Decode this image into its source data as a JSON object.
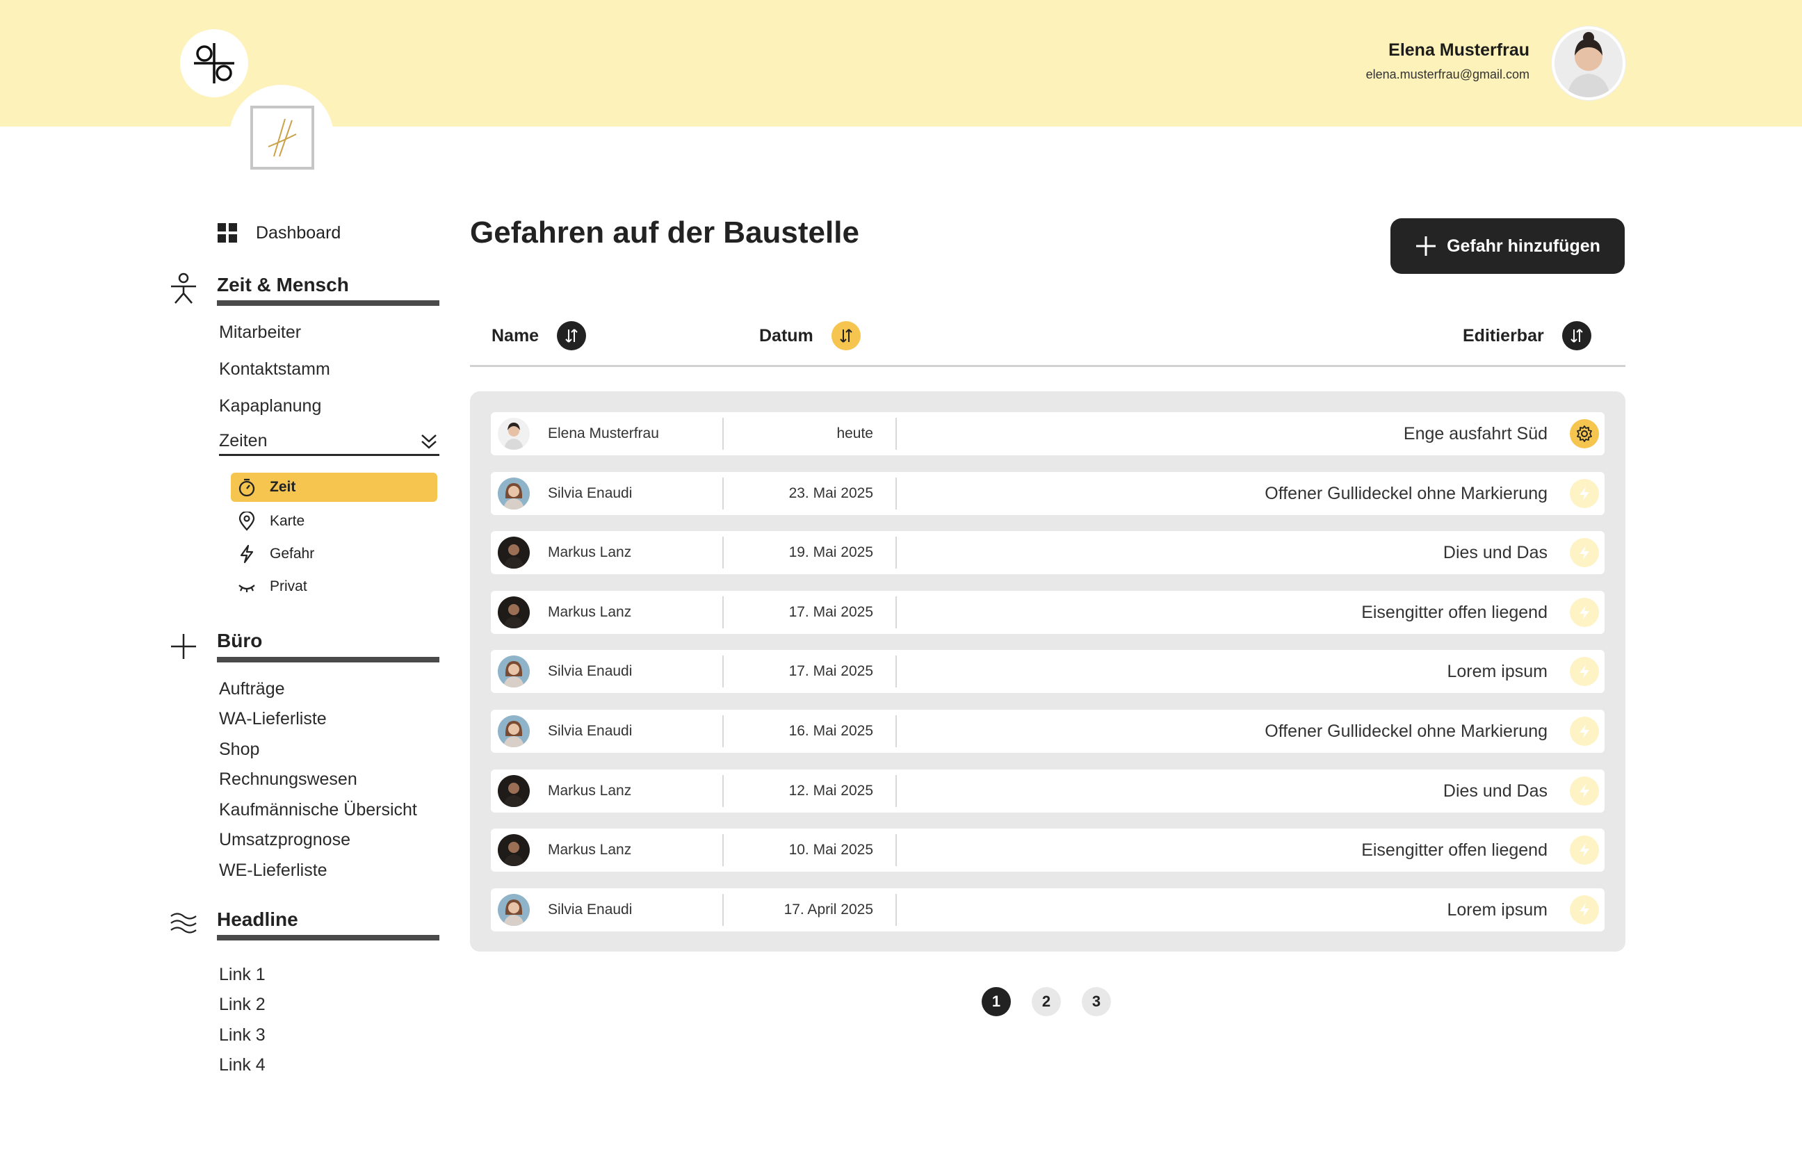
{
  "user": {
    "name": "Elena Musterfrau",
    "email": "elena.musterfrau@gmail.com"
  },
  "sidebar": {
    "dashboard": "Dashboard",
    "sections": [
      {
        "title": "Zeit & Mensch",
        "icon": "person-icon"
      },
      {
        "title": "Büro",
        "icon": "plus-icon"
      },
      {
        "title": "Headline",
        "icon": "waves-icon"
      }
    ],
    "zeit_links": [
      "Mitarbeiter",
      "Kontaktstamm",
      "Kapaplanung"
    ],
    "zeiten": "Zeiten",
    "zeiten_sub": [
      {
        "label": "Zeit",
        "icon": "stopwatch-icon",
        "active": true
      },
      {
        "label": "Karte",
        "icon": "location-pin-icon"
      },
      {
        "label": "Gefahr",
        "icon": "lightning-icon"
      },
      {
        "label": "Privat",
        "icon": "closed-eye-icon"
      }
    ],
    "buero_links": [
      "Aufträge",
      "WA-Lieferliste",
      "Shop",
      "Rechnungswesen",
      "Kaufmännische Übersicht",
      "Umsatzprognose",
      "WE-Lieferliste"
    ],
    "headline_links": [
      "Link 1",
      "Link 2",
      "Link 3",
      "Link 4"
    ]
  },
  "main": {
    "title": "Gefahren auf der Baustelle",
    "add_button": "Gefahr hinzufügen",
    "columns": {
      "name": "Name",
      "date": "Datum",
      "editable": "Editierbar"
    },
    "rows": [
      {
        "name": "Elena Musterfrau",
        "date": "heute",
        "desc": "Enge ausfahrt Süd",
        "action": "gear-icon",
        "tone": "light"
      },
      {
        "name": "Silvia Enaudi",
        "date": "23. Mai 2025",
        "desc": "Offener Gullideckel ohne Markierung",
        "action": "lightning-icon",
        "tone": "blue"
      },
      {
        "name": "Markus Lanz",
        "date": "19. Mai 2025",
        "desc": "Dies und Das",
        "action": "lightning-icon",
        "tone": "dark"
      },
      {
        "name": "Markus Lanz",
        "date": "17. Mai 2025",
        "desc": "Eisengitter offen liegend",
        "action": "lightning-icon",
        "tone": "dark"
      },
      {
        "name": "Silvia Enaudi",
        "date": "17. Mai 2025",
        "desc": "Lorem ipsum",
        "action": "lightning-icon",
        "tone": "blue"
      },
      {
        "name": "Silvia Enaudi",
        "date": "16. Mai 2025",
        "desc": "Offener Gullideckel ohne Markierung",
        "action": "lightning-icon",
        "tone": "blue"
      },
      {
        "name": "Markus Lanz",
        "date": "12. Mai 2025",
        "desc": "Dies und Das",
        "action": "lightning-icon",
        "tone": "dark"
      },
      {
        "name": "Markus Lanz",
        "date": "10. Mai 2025",
        "desc": "Eisengitter offen liegend",
        "action": "lightning-icon",
        "tone": "dark"
      },
      {
        "name": "Silvia Enaudi",
        "date": "17. April 2025",
        "desc": "Lorem ipsum",
        "action": "lightning-icon",
        "tone": "blue"
      }
    ],
    "pages": [
      "1",
      "2",
      "3"
    ]
  },
  "colors": {
    "accent": "#f5c54f",
    "topbar": "#fdf2b9",
    "dark": "#242424"
  }
}
